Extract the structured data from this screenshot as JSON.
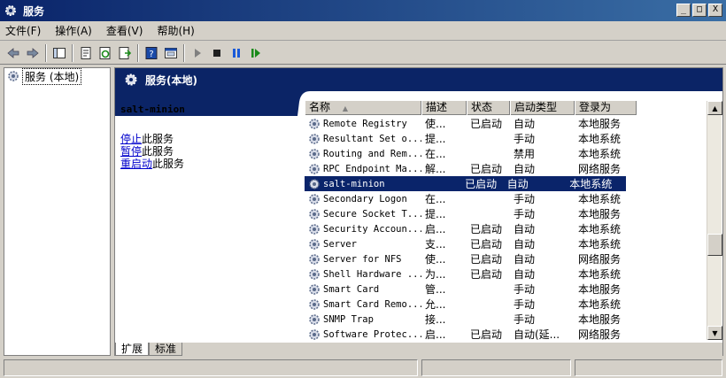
{
  "window": {
    "title": "服务",
    "buttons": [
      "_",
      "□",
      "X"
    ]
  },
  "menu": [
    "文件(F)",
    "操作(A)",
    "查看(V)",
    "帮助(H)"
  ],
  "toolbar": [
    "back-icon",
    "forward-icon",
    "console-tree-icon",
    "properties-icon",
    "refresh-icon",
    "export-icon",
    "help-icon",
    "view-icon",
    "start-icon",
    "stop-icon",
    "pause-icon",
    "restart-icon"
  ],
  "tree": {
    "root": "服务 (本地)"
  },
  "header": {
    "title": "服务(本地)"
  },
  "desc": {
    "service": "salt-minion",
    "links": [
      {
        "link": "停止",
        "suffix": "此服务"
      },
      {
        "link": "暂停",
        "suffix": "此服务"
      },
      {
        "link": "重启动",
        "suffix": "此服务"
      }
    ]
  },
  "columns": [
    "名称",
    "描述",
    "状态",
    "启动类型",
    "登录为"
  ],
  "rows": [
    {
      "name": "Remote Registry",
      "desc": "使...",
      "status": "已启动",
      "start": "自动",
      "logon": "本地服务"
    },
    {
      "name": "Resultant Set o...",
      "desc": "提...",
      "status": "",
      "start": "手动",
      "logon": "本地系统"
    },
    {
      "name": "Routing and Rem...",
      "desc": "在...",
      "status": "",
      "start": "禁用",
      "logon": "本地系统"
    },
    {
      "name": "RPC Endpoint Ma...",
      "desc": "解...",
      "status": "已启动",
      "start": "自动",
      "logon": "网络服务"
    },
    {
      "name": "salt-minion",
      "desc": "",
      "status": "已启动",
      "start": "自动",
      "logon": "本地系统",
      "selected": true
    },
    {
      "name": "Secondary Logon",
      "desc": "在...",
      "status": "",
      "start": "手动",
      "logon": "本地系统"
    },
    {
      "name": "Secure Socket T...",
      "desc": "提...",
      "status": "",
      "start": "手动",
      "logon": "本地服务"
    },
    {
      "name": "Security Accoun...",
      "desc": "启...",
      "status": "已启动",
      "start": "自动",
      "logon": "本地系统"
    },
    {
      "name": "Server",
      "desc": "支...",
      "status": "已启动",
      "start": "自动",
      "logon": "本地系统"
    },
    {
      "name": "Server for NFS",
      "desc": "使...",
      "status": "已启动",
      "start": "自动",
      "logon": "网络服务"
    },
    {
      "name": "Shell Hardware ...",
      "desc": "为...",
      "status": "已启动",
      "start": "自动",
      "logon": "本地系统"
    },
    {
      "name": "Smart Card",
      "desc": "管...",
      "status": "",
      "start": "手动",
      "logon": "本地服务"
    },
    {
      "name": "Smart Card Remo...",
      "desc": "允...",
      "status": "",
      "start": "手动",
      "logon": "本地系统"
    },
    {
      "name": "SNMP Trap",
      "desc": "接...",
      "status": "",
      "start": "手动",
      "logon": "本地服务"
    },
    {
      "name": "Software Protec...",
      "desc": "启...",
      "status": "已启动",
      "start": "自动(延...",
      "logon": "网络服务"
    }
  ],
  "tabs": [
    "扩展",
    "标准"
  ],
  "colors": {
    "title_start": "#0a246a",
    "title_end": "#3a6ea5",
    "header_band": "#0b2466",
    "selection": "#0a246a"
  }
}
